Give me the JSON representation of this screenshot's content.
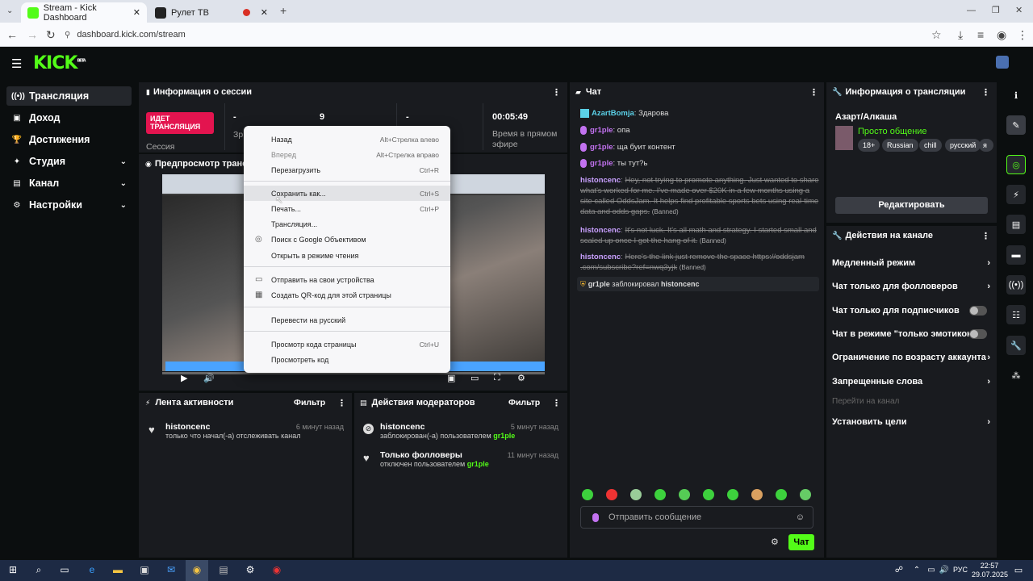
{
  "browser": {
    "tabs": [
      {
        "label": "Stream - Kick Dashboard",
        "close": "✕"
      },
      {
        "label": "Рулет ТВ",
        "close": "✕"
      }
    ],
    "new_tab": "+",
    "url": "dashboard.kick.com/stream",
    "win_min": "—",
    "win_max": "❐",
    "win_close": "✕"
  },
  "header": {
    "logo": "KICK",
    "logo_badge": "BETA"
  },
  "sidebar": {
    "items": [
      {
        "label": "Трансляция",
        "icon": "((•))"
      },
      {
        "label": "Доход",
        "icon": "▣"
      },
      {
        "label": "Достижения",
        "icon": "🏆"
      },
      {
        "label": "Студия",
        "icon": "✦",
        "chev": "⌄"
      },
      {
        "label": "Канал",
        "icon": "▤",
        "chev": "⌄"
      },
      {
        "label": "Настройки",
        "icon": "⚙",
        "chev": "⌄"
      }
    ]
  },
  "session": {
    "title": "Информация о сессии",
    "live_badge": "ИДЕТ ТРАНСЛЯЦИЯ",
    "session_label": "Сессия",
    "stat1_val": "-",
    "stat1_lbl": "Зр",
    "stat2_val": "9",
    "stat3_val": "-",
    "stat4_val": "00:05:49",
    "stat4_lbl": "Время в прямом эфире"
  },
  "preview": {
    "title": "Предпросмотр трансл"
  },
  "chat": {
    "title": "Чат",
    "messages": [
      {
        "user": "AzartBomja",
        "text": "Здарова",
        "color": "#5bd1e8",
        "banned": false
      },
      {
        "user": "gr1ple",
        "text": "опа",
        "color": "#c272f0",
        "banned": false
      },
      {
        "user": "gr1ple",
        "text": "ща буит контент",
        "color": "#c272f0",
        "banned": false
      },
      {
        "user": "gr1ple",
        "text": "ты тут?ь",
        "color": "#c272f0",
        "banned": false
      },
      {
        "user": "histoncenc",
        "text": "Hey, not trying to promote anything. Just wanted to share what's worked for me. I've made over $20K in a few months using a site called OddsJam. It helps find profitable sports bets using real-time data and odds gaps.",
        "color": "#c9a0ff",
        "banned": true
      },
      {
        "user": "histoncenc",
        "text": "It's not luck. It's all math and strategy. I started small and scaled up once I got the hang of it.",
        "color": "#c9a0ff",
        "banned": true
      },
      {
        "user": "histoncenc",
        "text": "Here's the link just remove the space https://oddsjam .com/subscribe?ref=nwq3yjk",
        "color": "#c9a0ff",
        "banned": true
      }
    ],
    "banned_tag": "(Banned)",
    "mod_notice": {
      "user": "gr1ple",
      "action": "заблокировал",
      "target": "histoncenc"
    },
    "input_placeholder": "Отправить сообщение",
    "send_label": "Чат"
  },
  "stream_info": {
    "title": "Информация о трансляции",
    "name": "Азарт/Алкаша",
    "category": "Просто общение",
    "tags": [
      "18+",
      "Russian",
      "chill",
      "русский",
      "я"
    ],
    "edit_label": "Редактировать"
  },
  "channel_actions": {
    "title": "Действия на канале",
    "items": [
      {
        "label": "Медленный режим",
        "type": "chevron"
      },
      {
        "label": "Чат только для фолловеров",
        "type": "chevron"
      },
      {
        "label": "Чат только для подписчиков",
        "type": "toggle"
      },
      {
        "label": "Чат в режиме \"только эмотиконы\"",
        "type": "toggle"
      },
      {
        "label": "Ограничение по возрасту аккаунта",
        "type": "chevron"
      },
      {
        "label": "Запрещенные слова",
        "type": "chevron"
      },
      {
        "label": "Перейти на канал",
        "type": "disabled"
      },
      {
        "label": "Установить цели",
        "type": "chevron"
      }
    ]
  },
  "activity": {
    "title": "Лента активности",
    "filter": "Фильтр",
    "items": [
      {
        "name": "histoncenc",
        "desc": "только что начал(-а) отслеживать канал",
        "time": "6 минут назад"
      }
    ]
  },
  "mod_actions": {
    "title": "Действия модераторов",
    "filter": "Фильтр",
    "items": [
      {
        "name": "histoncenc",
        "desc": "заблокирован(-а) пользователем",
        "by": "gr1ple",
        "time": "5 минут назад"
      },
      {
        "name": "Только фолловеры",
        "desc": "отключен пользователем",
        "by": "gr1ple",
        "time": "11 минут назад"
      }
    ]
  },
  "context_menu": {
    "items": [
      {
        "label": "Назад",
        "shortcut": "Alt+Стрелка влево"
      },
      {
        "label": "Вперед",
        "shortcut": "Alt+Стрелка вправо"
      },
      {
        "label": "Перезагрузить",
        "shortcut": "Ctrl+R"
      },
      {
        "label": "Сохранить как...",
        "shortcut": "Ctrl+S"
      },
      {
        "label": "Печать...",
        "shortcut": "Ctrl+P"
      },
      {
        "label": "Трансляция...",
        "shortcut": ""
      },
      {
        "label": "Поиск с Google Объективом",
        "shortcut": ""
      },
      {
        "label": "Открыть в режиме чтения",
        "shortcut": ""
      },
      {
        "label": "Отправить на свои устройства",
        "shortcut": ""
      },
      {
        "label": "Создать QR-код для этой страницы",
        "shortcut": ""
      },
      {
        "label": "Перевести на русский",
        "shortcut": ""
      },
      {
        "label": "Просмотр кода страницы",
        "shortcut": "Ctrl+U"
      },
      {
        "label": "Просмотреть код",
        "shortcut": ""
      }
    ]
  },
  "taskbar": {
    "lang": "РУС",
    "time": "22:57",
    "date": "29.07.2025"
  }
}
